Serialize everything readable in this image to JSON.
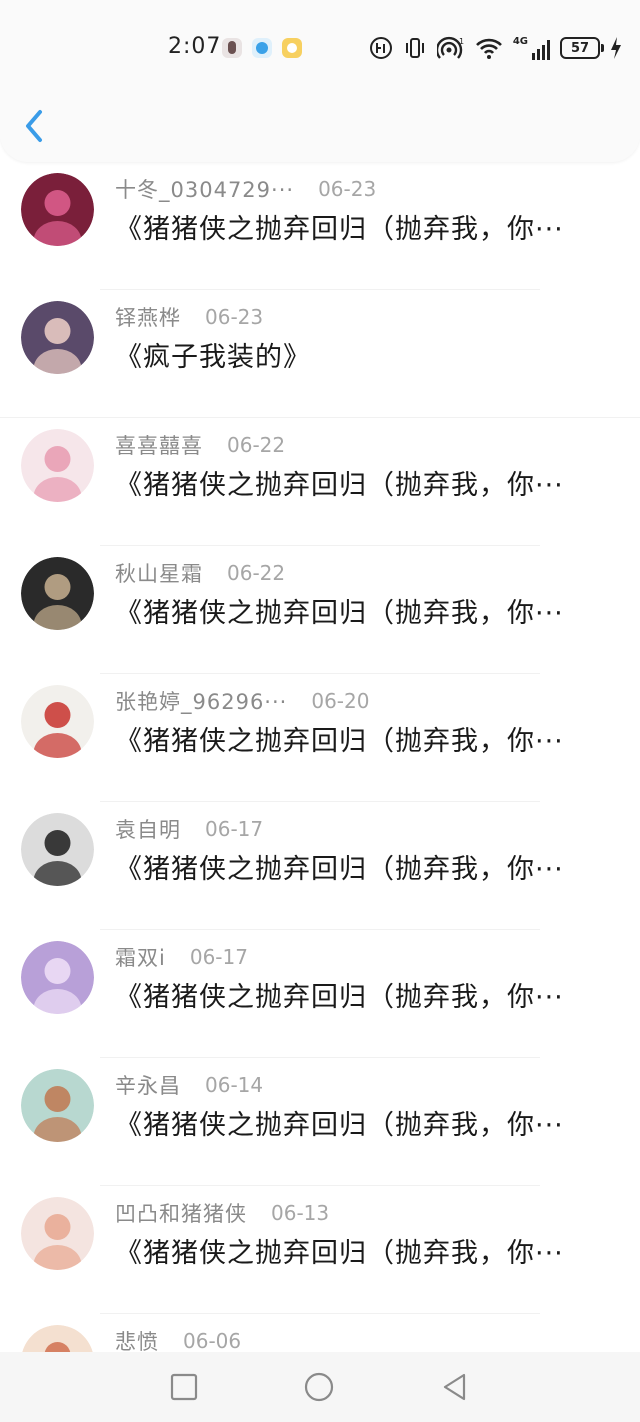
{
  "status_bar": {
    "time": "2:07",
    "signal_label": "4G",
    "battery": "57"
  },
  "comments": [
    {
      "user": "十冬_0304729···",
      "date": "06-23",
      "text": "《猪猪侠之抛弃回归（抛弃我，你···",
      "avatar_bg": "#7a1f3a",
      "avatar_fg": "#e06090"
    },
    {
      "user": "铎燕桦",
      "date": "06-23",
      "text": "《疯子我装的》",
      "avatar_bg": "#5a4a6a",
      "avatar_fg": "#f0d0c8"
    },
    {
      "user": "喜喜囍喜",
      "date": "06-22",
      "text": "《猪猪侠之抛弃回归（抛弃我，你···",
      "avatar_bg": "#f6e6ea",
      "avatar_fg": "#e89ab0"
    },
    {
      "user": "秋山星霜",
      "date": "06-22",
      "text": "《猪猪侠之抛弃回归（抛弃我，你···",
      "avatar_bg": "#2a2a2a",
      "avatar_fg": "#c8b090"
    },
    {
      "user": "张艳婷_96296···",
      "date": "06-20",
      "text": "《猪猪侠之抛弃回归（抛弃我，你···",
      "avatar_bg": "#f2f0ec",
      "avatar_fg": "#c8322e"
    },
    {
      "user": "袁自明",
      "date": "06-17",
      "text": "《猪猪侠之抛弃回归（抛弃我，你···",
      "avatar_bg": "#dcdcdc",
      "avatar_fg": "#1c1c1c"
    },
    {
      "user": "霜双i",
      "date": "06-17",
      "text": "《猪猪侠之抛弃回归（抛弃我，你···",
      "avatar_bg": "#b8a0d8",
      "avatar_fg": "#f0e0f8"
    },
    {
      "user": "辛永昌",
      "date": "06-14",
      "text": "《猪猪侠之抛弃回归（抛弃我，你···",
      "avatar_bg": "#b8d8d0",
      "avatar_fg": "#c07850"
    },
    {
      "user": "凹凸和猪猪侠",
      "date": "06-13",
      "text": "《猪猪侠之抛弃回归（抛弃我，你···",
      "avatar_bg": "#f4e4e0",
      "avatar_fg": "#e8a890"
    },
    {
      "user": "悲愤",
      "date": "06-06",
      "text": "",
      "avatar_bg": "#f4e0d0",
      "avatar_fg": "#d07050"
    }
  ],
  "icons": {
    "back": "chevron-left-icon",
    "nav_recent": "square-icon",
    "nav_home": "circle-icon",
    "nav_back": "triangle-icon"
  },
  "colors": {
    "accent": "#3a9ce8",
    "username": "#8a8a8a",
    "date": "#a6a6a6",
    "text": "#1a1a1a"
  }
}
